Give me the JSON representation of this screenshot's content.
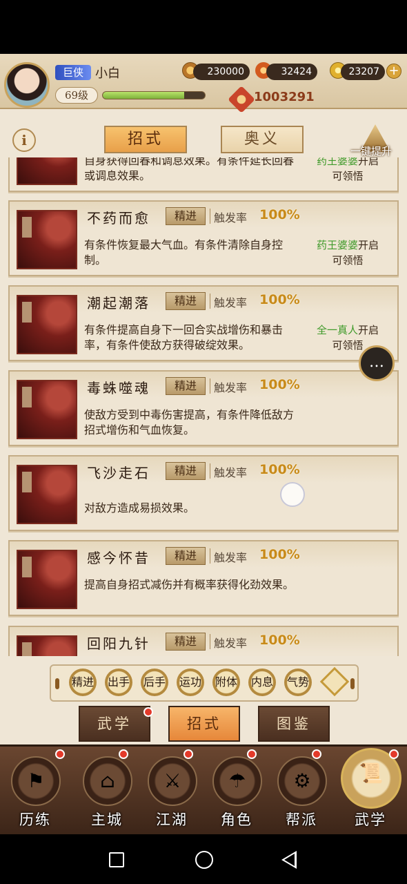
{
  "player": {
    "title_badge": "巨侠",
    "name": "小白",
    "level": "69级",
    "exp_fraction": 0.8,
    "power": "1003291"
  },
  "resources": {
    "copper": "230000",
    "fire": "32424",
    "gold": "23207"
  },
  "tabs": {
    "active": "招式",
    "inactive": "奥义",
    "onekey": "一键提升"
  },
  "common": {
    "refine": "精进",
    "trigger_label": "触发率",
    "unlock_suffix": "开启",
    "unlock_line2": "可领悟"
  },
  "skills": [
    {
      "name": "",
      "rate": "",
      "desc": "自身获得回春和调息效果。有条件延长回春或调息效果。",
      "unlock_by": "药王婆婆"
    },
    {
      "name": "不药而愈",
      "rate": "100%",
      "desc": "有条件恢复最大气血。有条件清除自身控制。",
      "unlock_by": "药王婆婆"
    },
    {
      "name": "潮起潮落",
      "rate": "100%",
      "desc": "有条件提高自身下一回合实战增伤和暴击率，有条件使敌方获得破绽效果。",
      "unlock_by": "全一真人"
    },
    {
      "name": "毒蛛噬魂",
      "rate": "100%",
      "desc": "使敌方受到中毒伤害提高，有条件降低敌方招式增伤和气血恢复。",
      "unlock_by": ""
    },
    {
      "name": "飞沙走石",
      "rate": "100%",
      "desc": "对敌方造成易损效果。",
      "unlock_by": ""
    },
    {
      "name": "感今怀昔",
      "rate": "100%",
      "desc": "提高自身招式减伤并有概率获得化劲效果。",
      "unlock_by": ""
    },
    {
      "name": "回阳九针",
      "rate": "100%",
      "desc": "",
      "unlock_by": ""
    }
  ],
  "filters": [
    "精进",
    "出手",
    "后手",
    "运功",
    "附体",
    "内息",
    "气势"
  ],
  "subtabs": [
    "武学",
    "招式",
    "图鉴"
  ],
  "nav": [
    {
      "label": "历练",
      "icon": "trial-icon"
    },
    {
      "label": "主城",
      "icon": "city-icon"
    },
    {
      "label": "江湖",
      "icon": "jianghu-icon"
    },
    {
      "label": "角色",
      "icon": "character-icon"
    },
    {
      "label": "帮派",
      "icon": "guild-icon"
    },
    {
      "label": "武学",
      "icon": "martial-arts-icon"
    }
  ],
  "colors": {
    "accent": "#e8a04a",
    "unlock_name": "#3f9a2a",
    "rate": "#c88a1a"
  }
}
